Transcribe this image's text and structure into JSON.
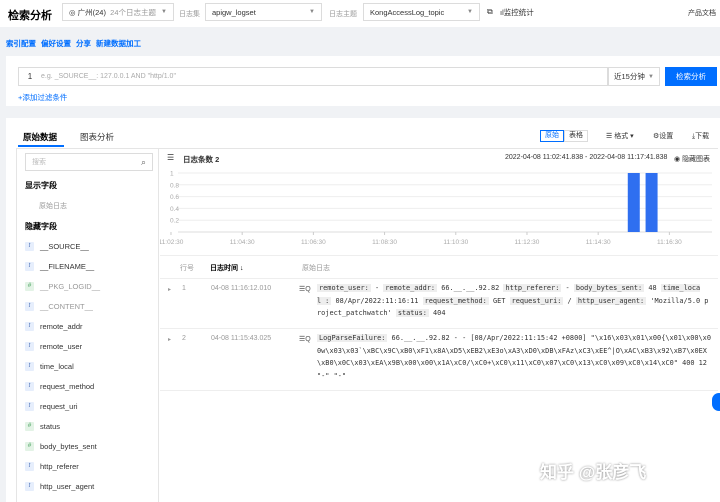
{
  "header": {
    "title": "检索分析",
    "region": "广州(24)",
    "topic_count": "24个日志主题",
    "logset_label": "日志集",
    "logset": "apigw_logset",
    "topic_label": "日志主题",
    "topic": "KongAccessLog_topic",
    "monitor": "监控统计",
    "docs": "产品文档"
  },
  "links": [
    "索引配置",
    "偏好设置",
    "分享",
    "新建数据加工"
  ],
  "query": {
    "line": "1",
    "placeholder": "e.g. _SOURCE__: 127.0.0.1 AND \"http/1.0\"",
    "time_range": "近15分钟",
    "search_button": "检索分析",
    "add_filter": "添加过滤条件"
  },
  "tabs": [
    "原始数据",
    "图表分析"
  ],
  "toolbar": {
    "raw": "原始",
    "table": "表格",
    "format": "格式",
    "settings": "设置",
    "download": "下载"
  },
  "sidebar": {
    "search_placeholder": "搜索",
    "shown_title": "显示字段",
    "shown": [
      "原始日志"
    ],
    "hidden_title": "隐藏字段",
    "fields": [
      {
        "name": "__SOURCE__",
        "type": "t"
      },
      {
        "name": "__FILENAME__",
        "type": "t"
      },
      {
        "name": "__PKG_LOGID__",
        "type": "#",
        "dim": true
      },
      {
        "name": "__CONTENT__",
        "type": "t",
        "dim": true
      },
      {
        "name": "remote_addr",
        "type": "t"
      },
      {
        "name": "remote_user",
        "type": "t"
      },
      {
        "name": "time_local",
        "type": "t"
      },
      {
        "name": "request_method",
        "type": "t"
      },
      {
        "name": "request_uri",
        "type": "t"
      },
      {
        "name": "status",
        "type": "#"
      },
      {
        "name": "body_bytes_sent",
        "type": "#"
      },
      {
        "name": "http_referer",
        "type": "t"
      },
      {
        "name": "http_user_agent",
        "type": "t"
      }
    ]
  },
  "chart_header": {
    "count": "日志条数 2",
    "range": "2022-04-08 11:02:41.838 - 2022-04-08 11:17:41.838",
    "hide": "隐藏图表"
  },
  "chart_data": {
    "type": "bar",
    "y_ticks": [
      "1",
      "0.8",
      "0.6",
      "0.4",
      "0.2"
    ],
    "ylim": [
      0,
      1
    ],
    "x_ticks": [
      "11:02:30",
      "11:04:30",
      "11:06:30",
      "11:08:30",
      "11:10:30",
      "11:12:30",
      "11:14:30",
      "11:16:30"
    ],
    "bars": [
      {
        "time": "11:15:30",
        "value": 1
      },
      {
        "time": "11:16:00",
        "value": 1
      }
    ],
    "color": "#2f6ff0"
  },
  "table": {
    "headers": [
      "行号",
      "日志时间",
      "原始日志"
    ],
    "rows": [
      {
        "no": "1",
        "time": "04-08 11:16:12.010",
        "segments": [
          [
            "remote_user:",
            " - "
          ],
          [
            "remote_addr:",
            " 66.__.__.92.82 "
          ],
          [
            "http_referer:",
            " - "
          ],
          [
            "body_bytes_sent:",
            " 48 "
          ],
          [
            "time_local",
            ""
          ],
          [
            ":",
            " 08/Apr/2022:11:16:11 "
          ],
          [
            "request_method:",
            " GET "
          ],
          [
            "request_uri:",
            " / "
          ],
          [
            "http_user_agent:",
            " 'Mozilla/5.0 project_patchwatch' "
          ],
          [
            "status:",
            " 404"
          ]
        ]
      },
      {
        "no": "2",
        "time": "04-08 11:15:43.025",
        "segments": [
          [
            "LogParseFailure:",
            " 66.__.__.92.82 - - [08/Apr/2022:11:15:42 +0800] \"\\x16\\x03\\x01\\x00{\\x01\\x00\\x00w\\x03\\x03`\\xBC\\x9C\\xB0\\xF1\\x8A\\xD5\\xEB2\\xE3o\\xA3\\xD0\\xDB\\xFAz\\xC3\\xEE^|O\\xAC\\xB3\\x92\\xB7\\x0EX\\xB0\\x0C\\x03\\xEA\\x9B\\x00\\x00\\x1A\\xC0/\\xC0+\\xC0\\x11\\xC0\\x07\\xC0\\x13\\xC0\\x09\\xC0\\x14\\xC0\" 400 12 \"-\" \"-\""
          ]
        ]
      }
    ]
  },
  "watermark": "知乎 @张彦飞"
}
